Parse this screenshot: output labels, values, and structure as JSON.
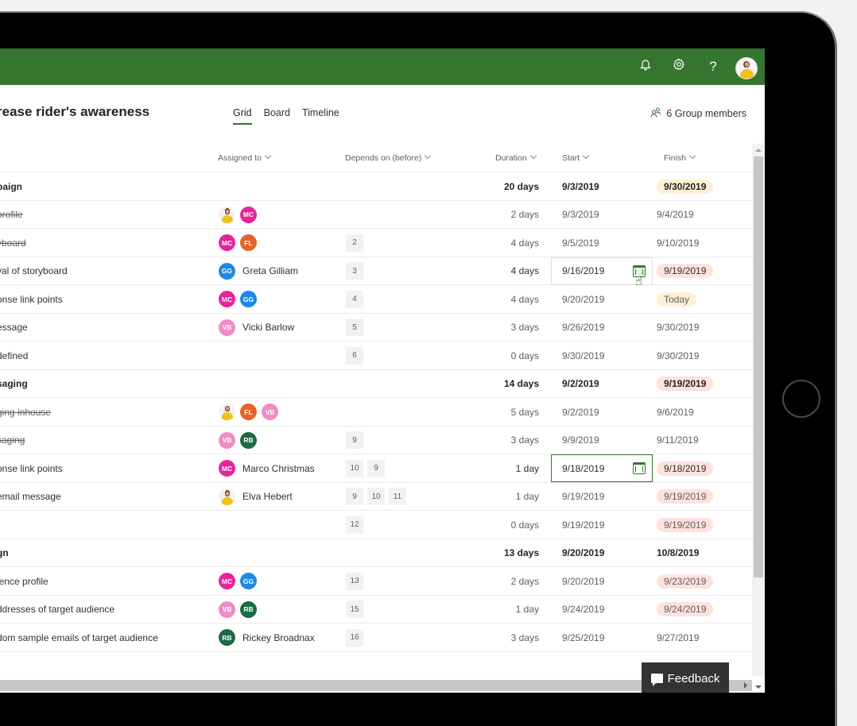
{
  "header": {
    "icons": [
      "bell-icon",
      "gear-icon",
      "help-icon",
      "user-avatar"
    ],
    "help_glyph": "?",
    "brand_color": "#35752f"
  },
  "plan": {
    "title": "rease rider's awareness",
    "tabs": [
      {
        "label": "Grid",
        "active": true
      },
      {
        "label": "Board",
        "active": false
      },
      {
        "label": "Timeline",
        "active": false
      }
    ],
    "members_label": "6 Group members"
  },
  "columns": {
    "assigned": "Assigned to",
    "depends": "Depends on (before)",
    "duration": "Duration",
    "start": "Start",
    "finish": "Finish"
  },
  "rows": [
    {
      "type": "group",
      "name": "paign",
      "duration": "20 days",
      "start": "9/3/2019",
      "finish": "9/30/2019",
      "finish_style": "warn"
    },
    {
      "type": "task",
      "done": true,
      "name": "profile",
      "assignees": [
        {
          "photo": true
        },
        {
          "initials": "MC",
          "color": "#e8249a"
        }
      ],
      "deps": [],
      "duration": "2 days",
      "start": "9/3/2019",
      "finish": "9/4/2019"
    },
    {
      "type": "task",
      "done": true,
      "name": "yboard",
      "assignees": [
        {
          "initials": "MC",
          "color": "#e8249a"
        },
        {
          "initials": "FL",
          "color": "#e8622b"
        }
      ],
      "deps": [
        "2"
      ],
      "duration": "4 days",
      "start": "9/5/2019",
      "finish": "9/10/2019"
    },
    {
      "type": "task",
      "name": "val of storyboard",
      "assignees": [
        {
          "initials": "GG",
          "color": "#1e88e5"
        }
      ],
      "assignee_name": "Greta Gilliam",
      "deps": [
        "3"
      ],
      "duration": "4 days",
      "start": "9/16/2019",
      "finish": "9/19/2019",
      "finish_style": "late",
      "edit": "hover"
    },
    {
      "type": "task",
      "name": "onse link points",
      "assignees": [
        {
          "initials": "MC",
          "color": "#e8249a"
        },
        {
          "initials": "GG",
          "color": "#1e88e5"
        }
      ],
      "deps": [
        "4"
      ],
      "duration": "4 days",
      "start": "9/20/2019",
      "finish": "Today",
      "finish_style": "warn"
    },
    {
      "type": "task",
      "name": "essage",
      "assignees": [
        {
          "initials": "VB",
          "color": "#f08cc4"
        }
      ],
      "assignee_name": "Vicki Barlow",
      "deps": [
        "5"
      ],
      "duration": "3 days",
      "start": "9/26/2019",
      "finish": "9/30/2019"
    },
    {
      "type": "task",
      "name": "defined",
      "assignees": [],
      "deps": [
        "6"
      ],
      "duration": "0 days",
      "start": "9/30/2019",
      "finish": "9/30/2019"
    },
    {
      "type": "group",
      "name": "saging",
      "duration": "14 days",
      "start": "9/2/2019",
      "finish": "9/19/2019",
      "finish_style": "late"
    },
    {
      "type": "task",
      "done": true,
      "name": "ging inhouse",
      "assignees": [
        {
          "photo": true
        },
        {
          "initials": "FL",
          "color": "#e8622b"
        },
        {
          "initials": "VB",
          "color": "#f08cc4"
        }
      ],
      "deps": [],
      "duration": "5 days",
      "start": "9/2/2019",
      "finish": "9/6/2019"
    },
    {
      "type": "task",
      "done": true,
      "name": "saging",
      "assignees": [
        {
          "initials": "VB",
          "color": "#f08cc4"
        },
        {
          "initials": "RB",
          "color": "#1b6b45"
        }
      ],
      "deps": [
        "9"
      ],
      "duration": "3 days",
      "start": "9/9/2019",
      "finish": "9/11/2019"
    },
    {
      "type": "task",
      "name": "onse link points",
      "assignees": [
        {
          "initials": "MC",
          "color": "#e8249a"
        }
      ],
      "assignee_name": "Marco Christmas",
      "deps": [
        "10",
        "9"
      ],
      "duration": "1 day",
      "start": "9/18/2019",
      "finish": "9/18/2019",
      "finish_style": "late",
      "edit": "focused"
    },
    {
      "type": "task",
      "name": "email message",
      "assignees": [
        {
          "photo": true
        }
      ],
      "assignee_name": "Elva Hebert",
      "deps": [
        "9",
        "10",
        "11"
      ],
      "duration": "1 day",
      "start": "9/19/2019",
      "finish": "9/19/2019",
      "finish_style": "late"
    },
    {
      "type": "task",
      "name": "",
      "assignees": [],
      "deps": [
        "12"
      ],
      "duration": "0 days",
      "start": "9/19/2019",
      "finish": "9/19/2019",
      "finish_style": "late"
    },
    {
      "type": "group",
      "name": "gn",
      "duration": "13 days",
      "start": "9/20/2019",
      "finish": "10/8/2019"
    },
    {
      "type": "task",
      "name": "ience profile",
      "assignees": [
        {
          "initials": "MC",
          "color": "#e8249a"
        },
        {
          "initials": "GG",
          "color": "#1e88e5"
        }
      ],
      "deps": [
        "13"
      ],
      "duration": "2 days",
      "start": "9/20/2019",
      "finish": "9/23/2019",
      "finish_style": "late"
    },
    {
      "type": "task",
      "name": "ddresses of target audience",
      "assignees": [
        {
          "initials": "VB",
          "color": "#f08cc4"
        },
        {
          "initials": "RB",
          "color": "#1b6b45"
        }
      ],
      "deps": [
        "15"
      ],
      "duration": "1 day",
      "start": "9/24/2019",
      "finish": "9/24/2019",
      "finish_style": "late"
    },
    {
      "type": "task",
      "name": "dom sample emails of target audience",
      "assignees": [
        {
          "initials": "RB",
          "color": "#1b6b45"
        }
      ],
      "assignee_name": "Rickey Broadnax",
      "deps": [
        "16"
      ],
      "duration": "3 days",
      "start": "9/25/2019",
      "finish": "9/27/2019"
    }
  ],
  "feedback": {
    "label": "Feedback"
  }
}
